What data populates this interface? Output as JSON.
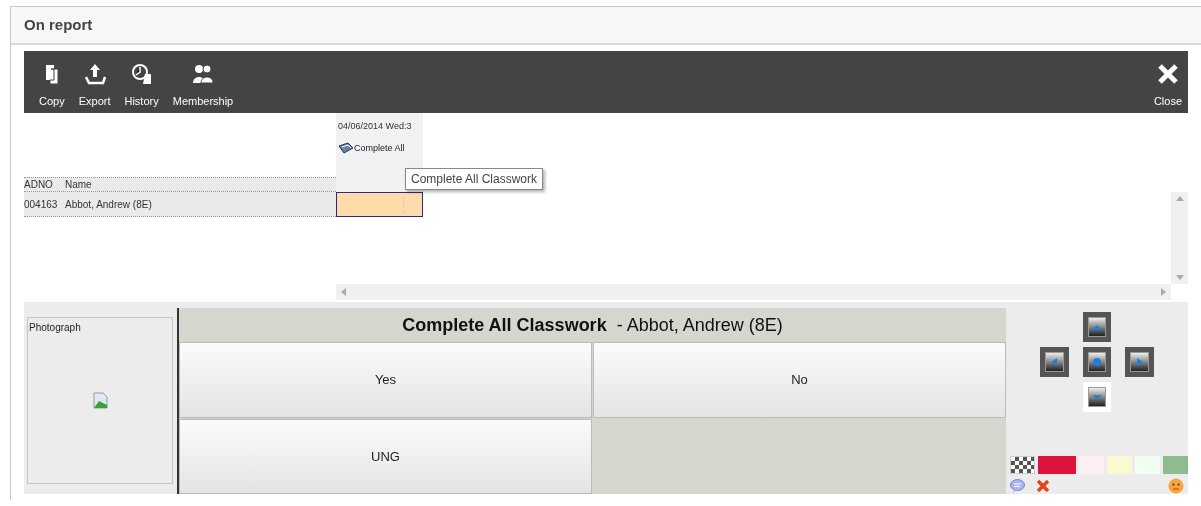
{
  "window": {
    "title": "On report"
  },
  "toolbar": {
    "buttons": [
      {
        "label": "Copy"
      },
      {
        "label": "Export"
      },
      {
        "label": "History"
      },
      {
        "label": "Membership"
      }
    ],
    "close": {
      "label": "Close"
    }
  },
  "grid": {
    "columns": [
      "ADNO",
      "Name"
    ],
    "date_column": {
      "date": "04/06/2014 Wed:3",
      "title": "Complete All"
    },
    "rows": [
      {
        "adno": "004163",
        "name": "Abbot, Andrew (8E)",
        "selected": true
      }
    ],
    "tooltip": "Complete All Classwork"
  },
  "photo": {
    "label": "Photograph"
  },
  "marking": {
    "heading": {
      "title": "Complete All Classwork",
      "student": "- Abbot, Andrew (8E)"
    },
    "options": [
      "Yes",
      "No",
      "UNG"
    ]
  },
  "swatches": [
    {
      "kind": "clear"
    },
    {
      "kind": "color",
      "color": "#dc143c"
    },
    {
      "kind": "color",
      "color": "#fff0f5"
    },
    {
      "kind": "color",
      "color": "#fafad2"
    },
    {
      "kind": "color",
      "color": "#f0fff0"
    },
    {
      "kind": "color",
      "color": "#8fbc8f"
    }
  ]
}
